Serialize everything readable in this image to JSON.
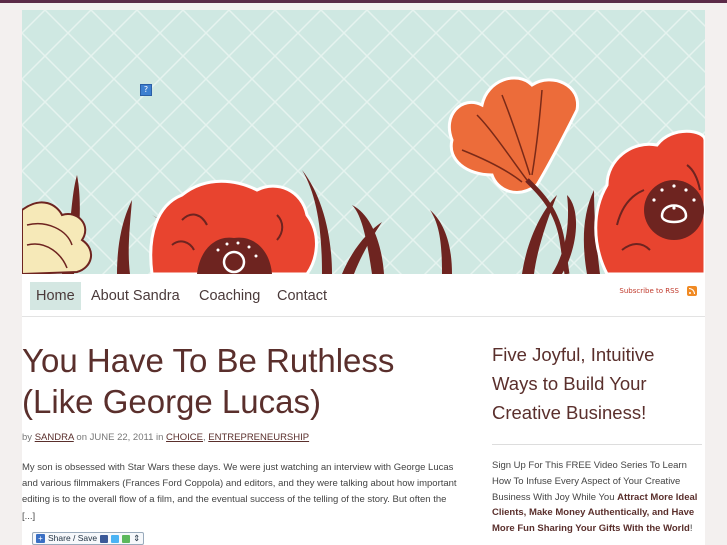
{
  "header": {
    "help_badge": "?"
  },
  "nav": {
    "items": [
      {
        "label": "Home",
        "active": true
      },
      {
        "label": "About Sandra",
        "active": false
      },
      {
        "label": "Coaching",
        "active": false
      },
      {
        "label": "Contact",
        "active": false
      }
    ],
    "rss_label": "Subscribe to RSS"
  },
  "post": {
    "title_line1": "You Have To Be Ruthless",
    "title_line2": "(Like George Lucas)",
    "meta": {
      "by": "by",
      "author": "SANDRA",
      "on": "on",
      "date": "JUNE 22, 2011",
      "in": "in",
      "cat1": "CHOICE",
      "sep": ",",
      "cat2": "ENTREPRENEURSHIP"
    },
    "excerpt": "My son is obsessed with Star Wars these days. We were just watching an interview with George Lucas and various filmmakers (Frances Ford Coppola) and editors, and they were talking about how important editing is to the overall flow of a film, and the eventual success of the telling of the story. But often the [...]",
    "share_label": "Share / Save"
  },
  "sidebar": {
    "title": "Five Joyful, Intuitive Ways to Build Your Creative Business!",
    "promo_lead": "Sign Up For This FREE Video Series To Learn How To Infuse Every Aspect of Your Creative Business With Joy While You",
    "promo_bold": "Attract More Ideal Clients, Make Money Authentically, and Have More Fun Sharing Your Gifts With the World",
    "promo_end": "!"
  },
  "colors": {
    "accent": "#5a2f2c",
    "header_bg": "#cfe8e2",
    "nav_active": "#d4e7e2",
    "poppy": "#e8442f",
    "top_bar": "#5b2a47"
  }
}
